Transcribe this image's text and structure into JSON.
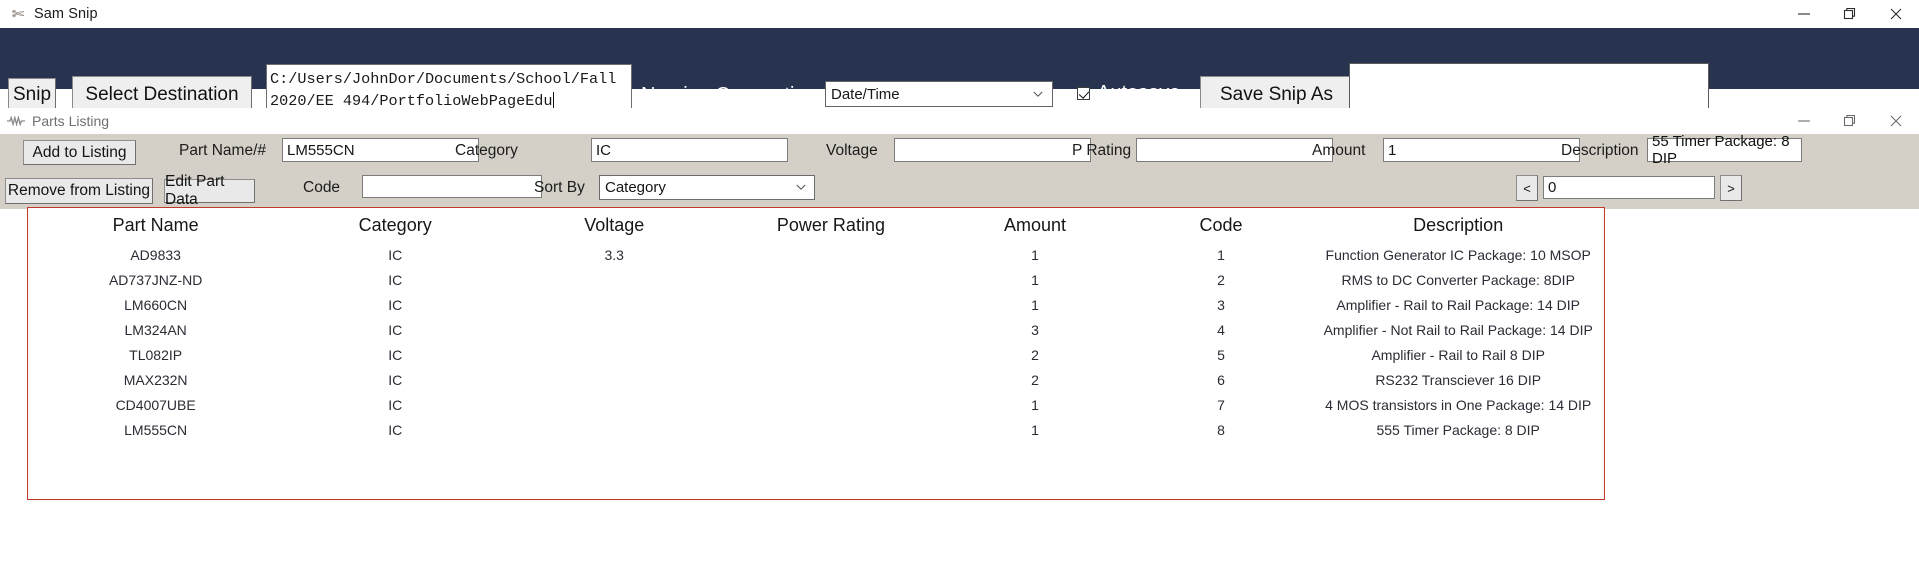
{
  "window": {
    "title": "Sam Snip",
    "icon": "scissors-icon",
    "minimize": "—",
    "maximize": "❐",
    "close": "✕"
  },
  "toolbar": {
    "snip_label": "Snip",
    "select_destination_label": "Select Destination",
    "destination_path": "C:/Users/JohnDor/Documents/School/Fall 2020/EE 494/PortfolioWebPageEdu",
    "naming_convention_label": "Naming Convention",
    "naming_convention_value": "Date/Time",
    "naming_convention_options": [
      "Date/Time"
    ],
    "autosave_label": "Autosave",
    "autosave_checked": true,
    "save_snip_as_label": "Save Snip As",
    "preview_value": "",
    "background_color": "#27334f"
  },
  "subwindow": {
    "title": "Parts Listing",
    "icon": "resistor-icon",
    "minimize": "—",
    "maximize": "❐",
    "close": "✕",
    "form": {
      "add_to_listing_label": "Add to Listing",
      "remove_from_listing_label": "Remove from Listing",
      "edit_part_data_label": "Edit Part Data",
      "part_name_label": "Part Name/#",
      "part_name_value": "LM555CN",
      "category_label": "Category",
      "category_value": "IC",
      "voltage_label": "Voltage",
      "voltage_value": "",
      "p_rating_label": "P Rating",
      "p_rating_value": "",
      "amount_label": "Amount",
      "amount_value": "1",
      "description_label": "Description",
      "description_value": "55 Timer Package: 8 DIP",
      "code_label": "Code",
      "code_value": "",
      "sort_by_label": "Sort By",
      "sort_by_value": "Category",
      "sort_by_options": [
        "Category"
      ],
      "prev_page_label": "<",
      "next_page_label": ">",
      "page_value": "0"
    }
  },
  "table": {
    "border_color": "#c0392b",
    "columns": [
      "Part Name",
      "Category",
      "Voltage",
      "Power Rating",
      "Amount",
      "Code",
      "Description"
    ],
    "rows": [
      [
        "AD9833",
        "IC",
        "3.3",
        "",
        "1",
        "1",
        "Function Generator IC Package: 10 MSOP"
      ],
      [
        "AD737JNZ-ND",
        "IC",
        "",
        "",
        "1",
        "2",
        "RMS to DC Converter Package: 8DIP"
      ],
      [
        "LM660CN",
        "IC",
        "",
        "",
        "1",
        "3",
        "Amplifier - Rail to Rail Package: 14 DIP"
      ],
      [
        "LM324AN",
        "IC",
        "",
        "",
        "3",
        "4",
        "Amplifier - Not Rail to Rail Package: 14 DIP"
      ],
      [
        "TL082IP",
        "IC",
        "",
        "",
        "2",
        "5",
        "Amplifier - Rail to Rail 8 DIP"
      ],
      [
        "MAX232N",
        "IC",
        "",
        "",
        "2",
        "6",
        "RS232 Transciever 16 DIP"
      ],
      [
        "CD4007UBE",
        "IC",
        "",
        "",
        "1",
        "7",
        "4 MOS transistors in One Package: 14 DIP"
      ],
      [
        "LM555CN",
        "IC",
        "",
        "",
        "1",
        "8",
        "555 Timer Package: 8 DIP"
      ]
    ]
  }
}
